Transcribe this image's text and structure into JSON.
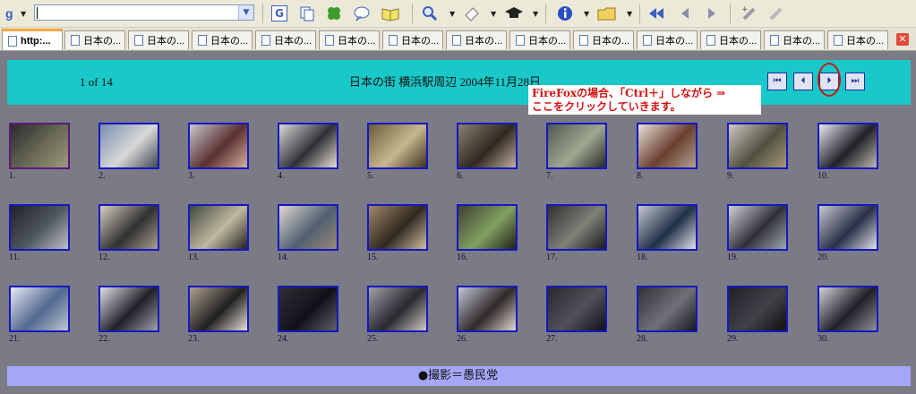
{
  "tabs": [
    {
      "label": "http:..."
    },
    {
      "label": "日本の..."
    },
    {
      "label": "日本の..."
    },
    {
      "label": "日本の..."
    },
    {
      "label": "日本の..."
    },
    {
      "label": "日本の..."
    },
    {
      "label": "日本の..."
    },
    {
      "label": "日本の..."
    },
    {
      "label": "日本の..."
    },
    {
      "label": "日本の..."
    },
    {
      "label": "日本の..."
    },
    {
      "label": "日本の..."
    },
    {
      "label": "日本の..."
    },
    {
      "label": "日本の..."
    }
  ],
  "toolbar": {
    "google_g": "G"
  },
  "page": {
    "count": "1 of 14",
    "title": "日本の街 横浜駅周辺 2004年11月28日",
    "nav": {
      "first": "⏮",
      "prev": "⏴",
      "next": "⏵",
      "last": "⏭"
    },
    "annotation_line1": "FireFoxの場合、「Ctrl＋」しながら ⇒",
    "annotation_line2": "ここをクリックしていきます。",
    "footer": "●撮影＝愚民党"
  },
  "thumbnails": [
    {
      "label": "1.",
      "colors": [
        "#2a2a30",
        "#6a6a55",
        "#a09a80"
      ]
    },
    {
      "label": "2.",
      "colors": [
        "#7a8fb0",
        "#d8d8d8",
        "#404850"
      ]
    },
    {
      "label": "3.",
      "colors": [
        "#c8c8d0",
        "#5a3030",
        "#d8b0a0"
      ]
    },
    {
      "label": "4.",
      "colors": [
        "#d8d8d8",
        "#303038",
        "#e8e0d0"
      ]
    },
    {
      "label": "5.",
      "colors": [
        "#6b5b3a",
        "#c8b890",
        "#403020"
      ]
    },
    {
      "label": "6.",
      "colors": [
        "#8a8070",
        "#302820",
        "#c0b0a0"
      ]
    },
    {
      "label": "7.",
      "colors": [
        "#505850",
        "#a0a890",
        "#282828"
      ]
    },
    {
      "label": "8.",
      "colors": [
        "#e8e0d8",
        "#6a4030",
        "#b0a090"
      ]
    },
    {
      "label": "9.",
      "colors": [
        "#d0c8c0",
        "#505040",
        "#a89878"
      ]
    },
    {
      "label": "10.",
      "colors": [
        "#e8e8f0",
        "#202028",
        "#c0b8b0"
      ]
    },
    {
      "label": "11.",
      "colors": [
        "#202028",
        "#505860",
        "#c0c0c8"
      ]
    },
    {
      "label": "12.",
      "colors": [
        "#d8d0c0",
        "#303030",
        "#a8a090"
      ]
    },
    {
      "label": "13.",
      "colors": [
        "#404840",
        "#c0b8a0",
        "#202020"
      ]
    },
    {
      "label": "14.",
      "colors": [
        "#e0d8d0",
        "#506070",
        "#9a8878"
      ]
    },
    {
      "label": "15.",
      "colors": [
        "#a08868",
        "#302820",
        "#d0c0a0"
      ]
    },
    {
      "label": "16.",
      "colors": [
        "#404030",
        "#80a060",
        "#202018"
      ]
    },
    {
      "label": "17.",
      "colors": [
        "#303030",
        "#808078",
        "#1a1a1a"
      ]
    },
    {
      "label": "18.",
      "colors": [
        "#c8c8d0",
        "#203048",
        "#e0e0e8"
      ]
    },
    {
      "label": "19.",
      "colors": [
        "#d0d0d8",
        "#303038",
        "#a0a8b0"
      ]
    },
    {
      "label": "20.",
      "colors": [
        "#c8c8d0",
        "#283048",
        "#e0e0e8"
      ]
    },
    {
      "label": "21.",
      "colors": [
        "#e8e8f0",
        "#506890",
        "#c0c8d0"
      ]
    },
    {
      "label": "22.",
      "colors": [
        "#e0e0e8",
        "#202028",
        "#a0a0a8"
      ]
    },
    {
      "label": "23.",
      "colors": [
        "#b0a090",
        "#202020",
        "#e8e0d8"
      ]
    },
    {
      "label": "24.",
      "colors": [
        "#303038",
        "#101018",
        "#606068"
      ]
    },
    {
      "label": "25.",
      "colors": [
        "#a0a0a8",
        "#282830",
        "#d0c8c0"
      ]
    },
    {
      "label": "26.",
      "colors": [
        "#c0c8d8",
        "#302828",
        "#e0d8d0"
      ]
    },
    {
      "label": "27.",
      "colors": [
        "#282830",
        "#505058",
        "#101018"
      ]
    },
    {
      "label": "28.",
      "colors": [
        "#303038",
        "#707078",
        "#181820"
      ]
    },
    {
      "label": "29.",
      "colors": [
        "#202028",
        "#404048",
        "#101010"
      ]
    },
    {
      "label": "30.",
      "colors": [
        "#d0d0d8",
        "#202028",
        "#909098"
      ]
    }
  ]
}
